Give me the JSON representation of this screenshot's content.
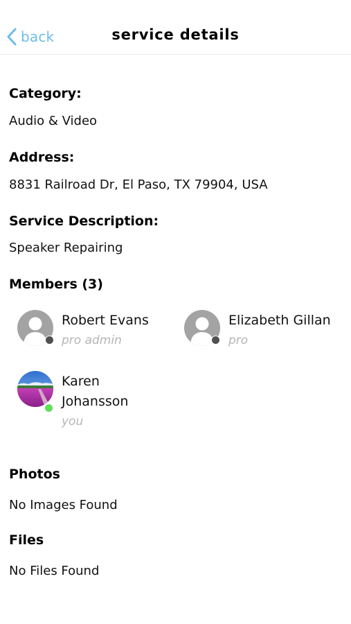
{
  "nav": {
    "back_label": "back",
    "title": "service details"
  },
  "details": {
    "category_label": "Category:",
    "category_value": "Audio & Video",
    "address_label": "Address:",
    "address_value": "8831 Railroad Dr, El Paso, TX 79904, USA",
    "description_label": "Service Description:",
    "description_value": "Speaker Repairing"
  },
  "members": {
    "heading": "Members (3)",
    "list": [
      {
        "name": "Robert Evans",
        "role": "pro admin",
        "status": "offline",
        "avatar": "person-silhouette-icon"
      },
      {
        "name": "Elizabeth Gillan",
        "role": "pro",
        "status": "offline",
        "avatar": "person-silhouette-icon"
      },
      {
        "name_line1": "Karen",
        "name_line2": "Johansson",
        "role": "you",
        "status": "online",
        "avatar": "landscape-photo"
      }
    ]
  },
  "photos": {
    "heading": "Photos",
    "empty_text": "No Images Found"
  },
  "files": {
    "heading": "Files",
    "empty_text": "No Files Found"
  },
  "colors": {
    "accent": "#6ebce8",
    "online": "#5ee05a",
    "offline": "#505050",
    "avatar_gray": "#a3a3a3",
    "role_text": "#b5b5b5"
  }
}
